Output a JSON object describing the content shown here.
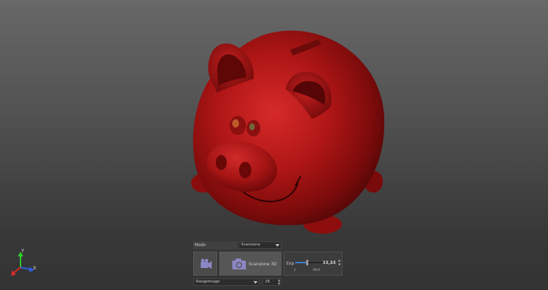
{
  "axes": {
    "x": "X",
    "y": "Y"
  },
  "panel": {
    "mode_label": "Modo",
    "mode_value": "Scansione",
    "camera_icon": "video-camera-icon",
    "scan_button_label": "Scansione 3D",
    "scan_icon": "camera-icon",
    "exp_label": "Exp",
    "exp_value": "33,33",
    "exp_min": "1",
    "exp_max": "99,9",
    "exp_fraction": 0.33,
    "output_value": "RangeImage",
    "output_number": "26"
  },
  "colors": {
    "model": "#b5121b",
    "background_top": "#686868",
    "background_bottom": "#333333"
  }
}
